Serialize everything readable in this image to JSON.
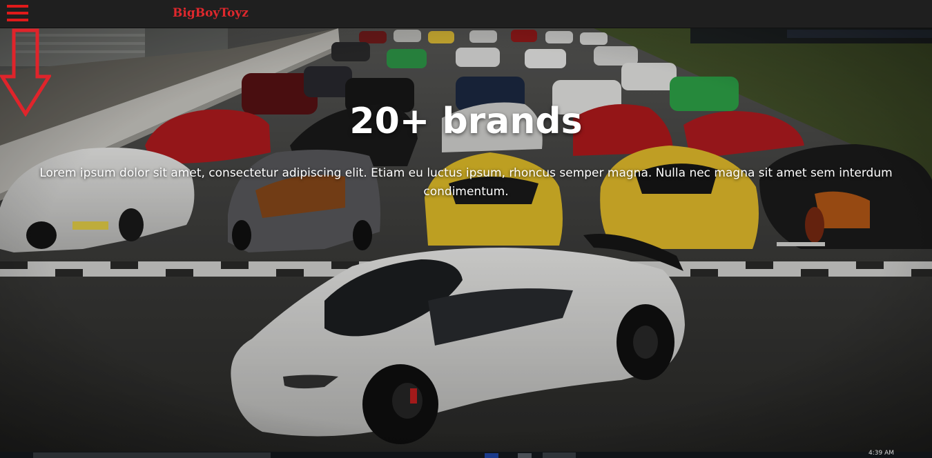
{
  "header": {
    "menu_icon": "hamburger-menu-icon",
    "brand": "BigBoyToyz"
  },
  "hero": {
    "title": "20+ brands",
    "description": "Lorem ipsum dolor sit amet, consectetur adipiscing elit. Etiam eu luctus ipsum, rhoncus semper magna. Nulla nec magna sit amet sem interdum condimentum.",
    "scroll_icon": "down-arrow-icon"
  },
  "taskbar": {
    "clock": "4:39 AM"
  },
  "colors": {
    "accent": "#e0282d",
    "navbar_bg": "#1f1f1f"
  }
}
